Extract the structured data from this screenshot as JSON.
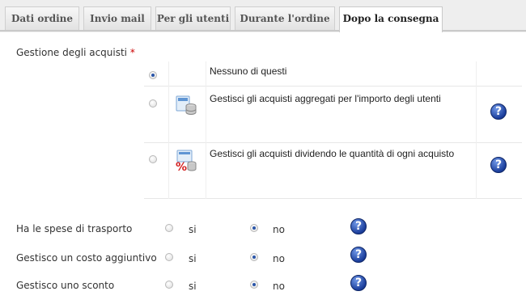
{
  "tabs": [
    "Dati ordine",
    "Invio mail",
    "Per gli utenti",
    "Durante l'ordine",
    "Dopo la consegna"
  ],
  "purchase_management": {
    "label": "Gestione degli acquisti",
    "required_mark": "*",
    "options": [
      {
        "label": "Nessuno di questi",
        "selected": true,
        "icon": "none",
        "help": false
      },
      {
        "label": "Gestisci gli acquisti aggregati per l'importo degli utenti",
        "selected": false,
        "icon": "database-stack-icon",
        "help": true
      },
      {
        "label": "Gestisci gli acquisti dividendo le quantità di ogni acquisto",
        "selected": false,
        "icon": "percent-discount-icon",
        "help": true
      }
    ]
  },
  "settings": [
    {
      "label": "Ha le spese di trasporto",
      "yes": "si",
      "no": "no",
      "value": "no"
    },
    {
      "label": "Gestisco un costo aggiuntivo",
      "yes": "si",
      "no": "no",
      "value": "no"
    },
    {
      "label": "Gestisco uno sconto",
      "yes": "si",
      "no": "no",
      "value": "no"
    }
  ],
  "help_symbol": "?",
  "colors": {
    "accent": "#1b3e9c",
    "required": "#cc0000",
    "tab_bar": "#eeeeee"
  }
}
